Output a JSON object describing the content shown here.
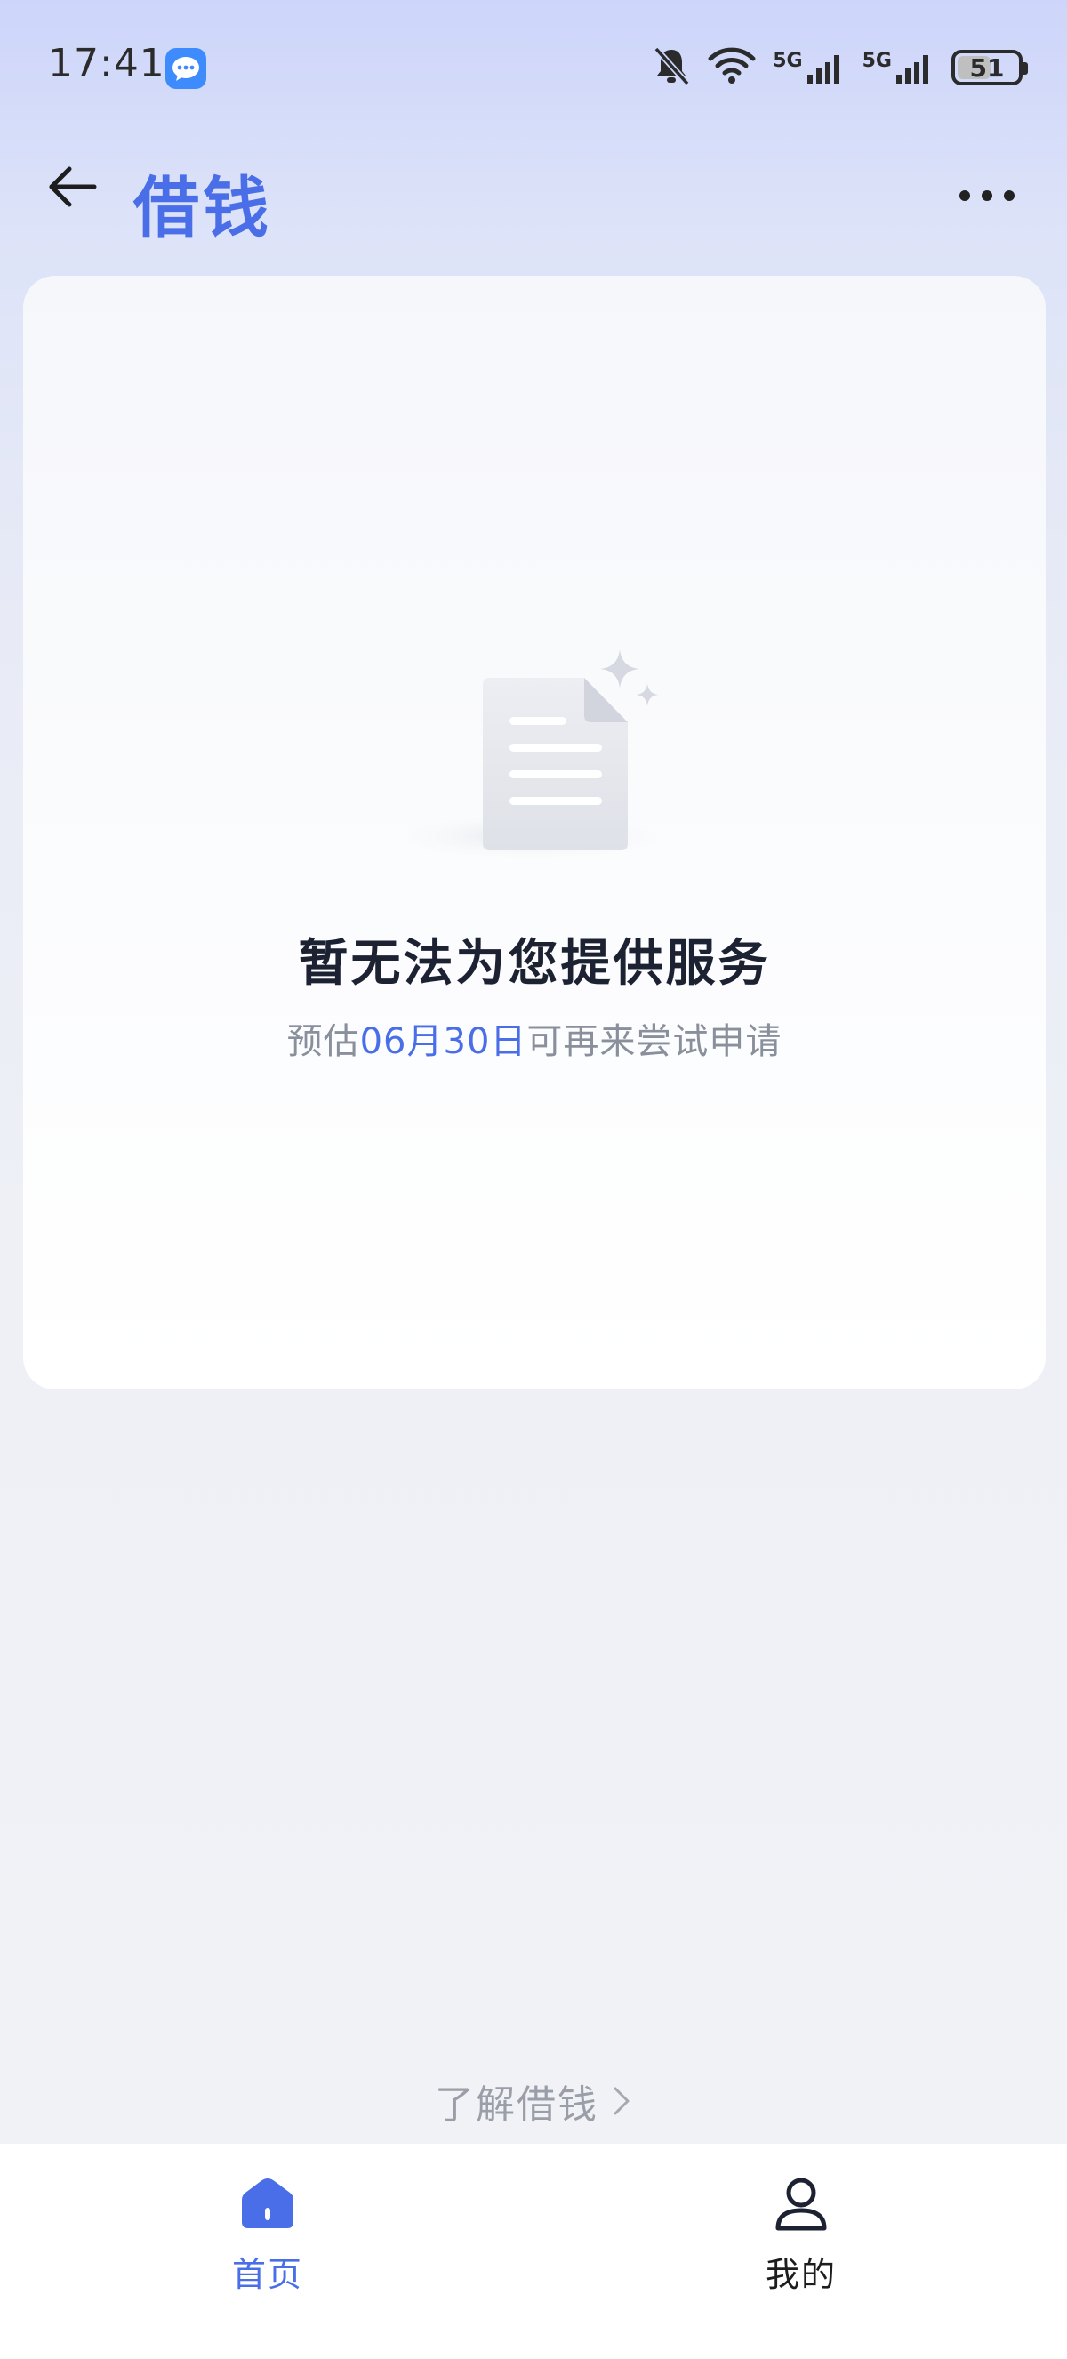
{
  "status_bar": {
    "time": "17:41",
    "battery": "51",
    "net_label_1": "5G",
    "net_label_2": "5G"
  },
  "header": {
    "title": "借钱"
  },
  "empty_state": {
    "title": "暂无法为您提供服务",
    "subtitle_prefix": "预估",
    "subtitle_date": "06月30日",
    "subtitle_suffix": "可再来尝试申请"
  },
  "learn_more": {
    "label": "了解借钱"
  },
  "tab_bar": {
    "tabs": [
      {
        "label": "首页",
        "icon": "home-icon",
        "active": true
      },
      {
        "label": "我的",
        "icon": "user-icon",
        "active": false
      }
    ]
  },
  "colors": {
    "accent": "#4a6ee8",
    "title_text": "#1d2233",
    "muted_text": "#8a8f9c"
  }
}
